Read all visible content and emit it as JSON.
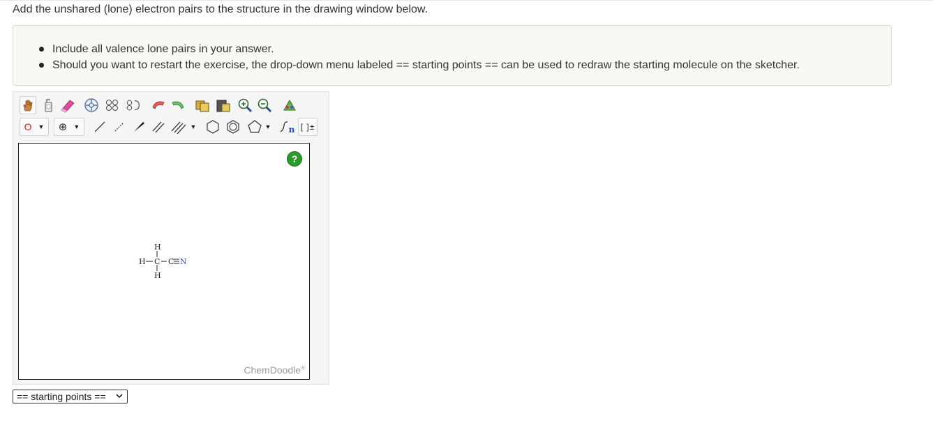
{
  "prompt": "Add the unshared (lone) electron pairs to the structure in the drawing window below.",
  "hints": [
    "Include all valence lone pairs in your answer.",
    "Should you want to restart the exercise, the drop-down menu labeled == starting points == can be used to redraw the starting molecule on the sketcher."
  ],
  "toolbar": {
    "row1": [
      "hand-icon",
      "clear-icon",
      "eraser-icon",
      "center-icon",
      "flip-horizontal-icon",
      "flip-vertical-icon",
      "undo-icon",
      "redo-icon",
      "copy-icon",
      "paste-icon",
      "zoom-in-icon",
      "zoom-out-icon",
      "clean-icon"
    ],
    "row2": {
      "element_label": "O",
      "charge_label": "⊕",
      "tools": [
        "single-bond-icon",
        "dashed-bond-icon",
        "wedge-bond-icon",
        "double-bond-icon",
        "triple-bond-icon",
        "cyclohexane-icon",
        "benzene-icon",
        "cyclopentane-icon",
        "sgroup-icon",
        "bracket-icon"
      ],
      "sgroup_label": "n",
      "bracket_label": "[ ]±"
    }
  },
  "canvas": {
    "help_label": "?",
    "brand": "ChemDoodle",
    "brand_mark": "®",
    "molecule": {
      "atoms": [
        {
          "id": "H_top",
          "label": "H"
        },
        {
          "id": "H_left",
          "label": "H"
        },
        {
          "id": "C1",
          "label": "C"
        },
        {
          "id": "C2",
          "label": "C"
        },
        {
          "id": "N",
          "label": "N"
        },
        {
          "id": "H_bottom",
          "label": "H"
        }
      ]
    }
  },
  "starting_points": {
    "selected": "== starting points =="
  },
  "colors": {
    "nitrogen": "#3050d8",
    "help_button": "#2a9a2a",
    "eraser": "#e04a9a"
  }
}
